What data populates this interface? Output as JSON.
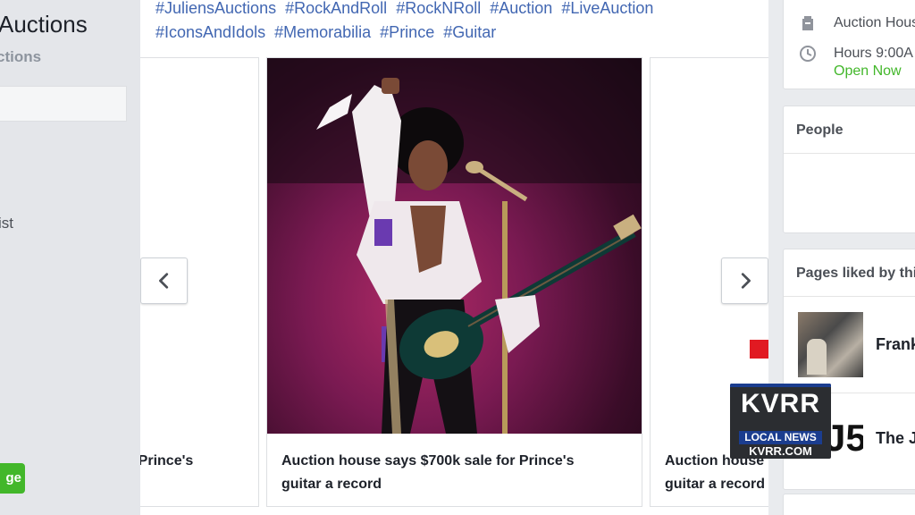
{
  "left_sidebar": {
    "page_title": "Auctions",
    "page_subtitle": "ctions",
    "nav_item": "ist",
    "like_button": "ge"
  },
  "post": {
    "hashtags": [
      "#JuliensAuctions",
      "#RockAndRoll",
      "#RockNRoll",
      "#Auction",
      "#LiveAuction",
      "#IconsAndIdols",
      "#Memorabilia",
      "#Prince",
      "#Guitar"
    ],
    "carousel": {
      "left_caption": "r Prince's",
      "main_caption_line1": "Auction house says $700k sale for Prince's",
      "main_caption_line2": "guitar a record",
      "right_caption_line1": "Auction house",
      "right_caption_line2": "guitar a record"
    }
  },
  "right_column": {
    "about": {
      "category": "Auction Hous",
      "hours": "Hours 9:00A",
      "status": "Open Now",
      "status_color": "#42b72a"
    },
    "people_title": "People",
    "pages_liked_title": "Pages liked by thi",
    "liked_pages": [
      {
        "name": "Frank"
      },
      {
        "name": "The J"
      }
    ]
  },
  "watermark": {
    "station": "KVRR",
    "tagline": "LOCAL NEWS",
    "url": "KVRR.COM"
  },
  "colors": {
    "link": "#4267b2",
    "accent_red": "#e11a22",
    "like_green": "#42b72a"
  }
}
